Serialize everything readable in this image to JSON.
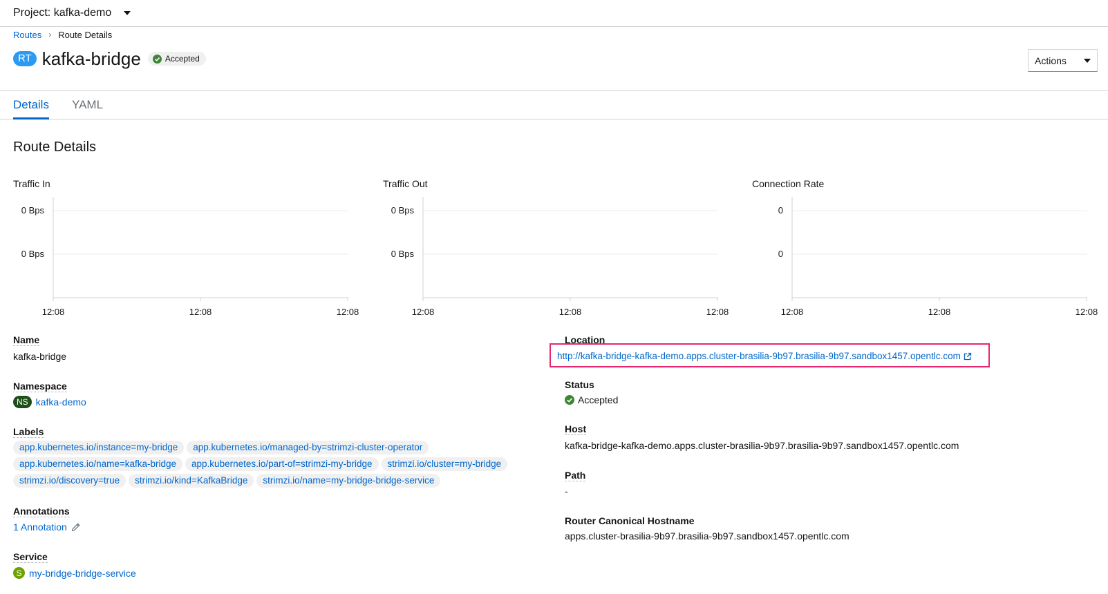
{
  "project": {
    "label": "Project: kafka-demo"
  },
  "breadcrumb": {
    "parent": "Routes",
    "current": "Route Details"
  },
  "heading": {
    "badge": "RT",
    "name": "kafka-bridge",
    "status": "Accepted"
  },
  "actions": {
    "label": "Actions"
  },
  "tabs": [
    {
      "label": "Details"
    },
    {
      "label": "YAML"
    }
  ],
  "section_title": "Route Details",
  "charts": [
    {
      "title": "Traffic In",
      "y_ticks": [
        "0 Bps",
        "0 Bps"
      ],
      "x_ticks": [
        "12:08",
        "12:08",
        "12:08"
      ]
    },
    {
      "title": "Traffic Out",
      "y_ticks": [
        "0 Bps",
        "0 Bps"
      ],
      "x_ticks": [
        "12:08",
        "12:08",
        "12:08"
      ]
    },
    {
      "title": "Connection Rate",
      "y_ticks": [
        "0",
        "0"
      ],
      "x_ticks": [
        "12:08",
        "12:08",
        "12:08"
      ]
    }
  ],
  "details": {
    "name": {
      "label": "Name",
      "value": "kafka-bridge"
    },
    "namespace": {
      "label": "Namespace",
      "badge": "NS",
      "value": "kafka-demo"
    },
    "labels": {
      "label": "Labels",
      "items": [
        "app.kubernetes.io/instance=my-bridge",
        "app.kubernetes.io/managed-by=strimzi-cluster-operator",
        "app.kubernetes.io/name=kafka-bridge",
        "app.kubernetes.io/part-of=strimzi-my-bridge",
        "strimzi.io/cluster=my-bridge",
        "strimzi.io/discovery=true",
        "strimzi.io/kind=KafkaBridge",
        "strimzi.io/name=my-bridge-bridge-service"
      ]
    },
    "annotations": {
      "label": "Annotations",
      "value": "1 Annotation"
    },
    "service": {
      "label": "Service",
      "badge": "S",
      "value": "my-bridge-bridge-service"
    },
    "location": {
      "label": "Location",
      "value": "http://kafka-bridge-kafka-demo.apps.cluster-brasilia-9b97.brasilia-9b97.sandbox1457.opentlc.com"
    },
    "status": {
      "label": "Status",
      "value": "Accepted"
    },
    "host": {
      "label": "Host",
      "value": "kafka-bridge-kafka-demo.apps.cluster-brasilia-9b97.brasilia-9b97.sandbox1457.opentlc.com"
    },
    "path": {
      "label": "Path",
      "value": "-"
    },
    "router": {
      "label": "Router Canonical Hostname",
      "value": "apps.cluster-brasilia-9b97.brasilia-9b97.sandbox1457.opentlc.com"
    }
  },
  "colors": {
    "link": "#0066cc",
    "accepted": "#3e8635",
    "highlight": "#e8266f",
    "rt_badge": "#2b9af3",
    "ns_badge": "#1e4f18",
    "s_badge": "#6ca100"
  }
}
